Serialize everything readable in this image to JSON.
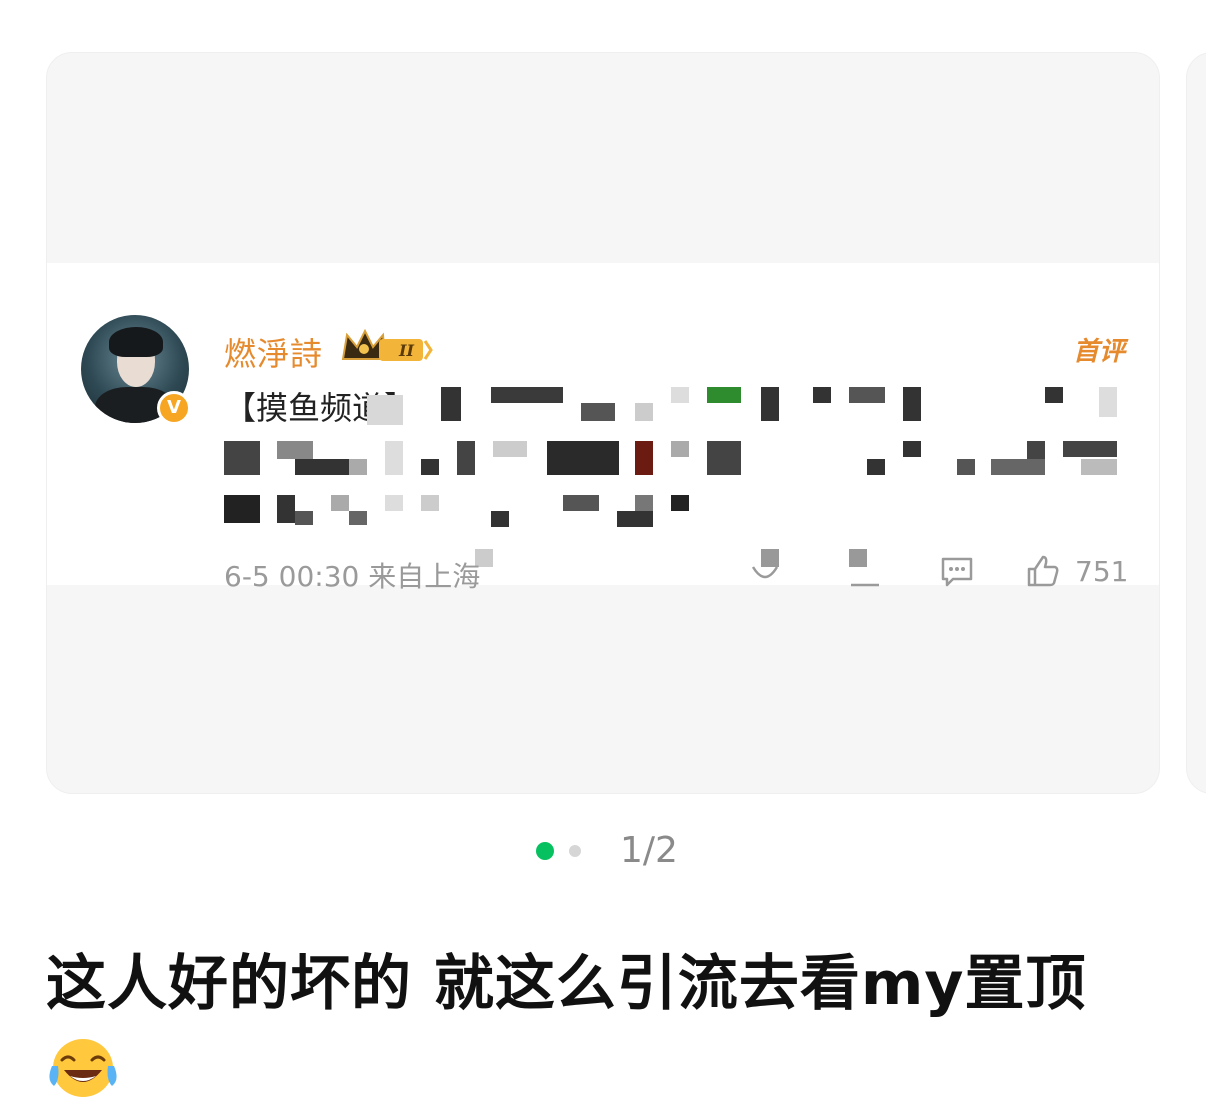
{
  "carousel": {
    "comment": {
      "username": "燃淨詩",
      "badge_level": "II",
      "first_comment_tag": "首评",
      "text_visible": "【摸鱼频道】",
      "timestamp": "6-5 00:30 来自上海",
      "like_count": "751"
    },
    "pagination": {
      "counter": "1/2",
      "active_index": 1,
      "total": 2
    }
  },
  "post": {
    "caption": "这人好的坏的 就这么引流去看my置顶",
    "emoji": "face-with-tears-of-joy-emoji"
  },
  "colors": {
    "accent_green": "#07c160",
    "username_orange": "#e68a2e",
    "meta_gray": "#9a9a9a"
  }
}
